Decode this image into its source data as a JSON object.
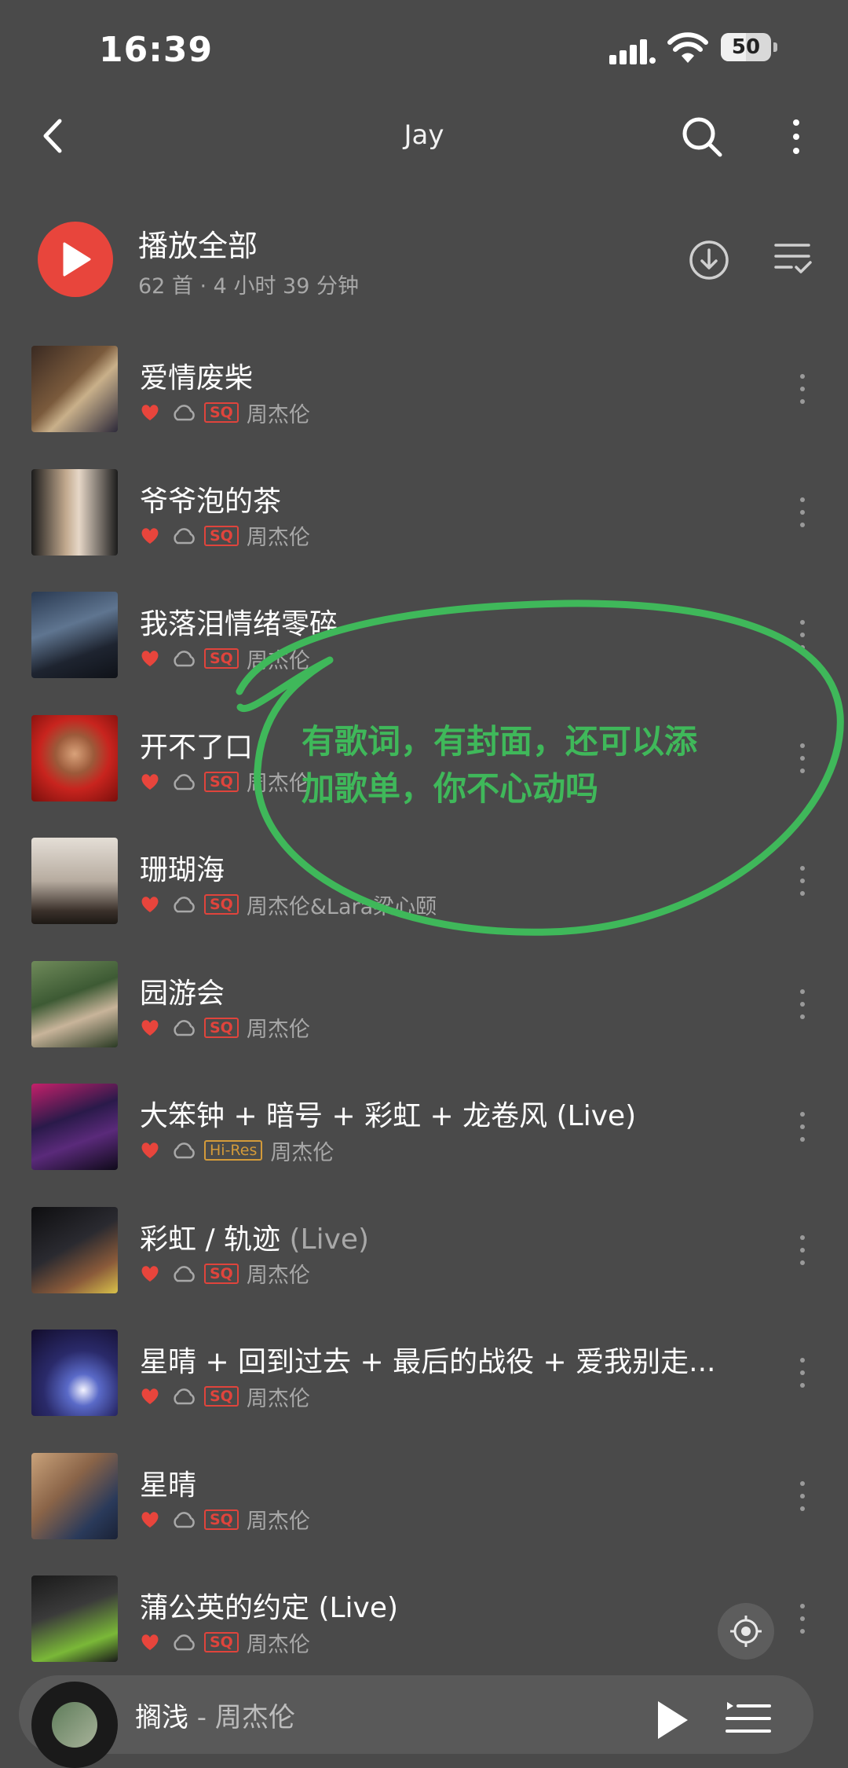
{
  "status_bar": {
    "time": "16:39",
    "battery": "50",
    "battery_level": 0.5
  },
  "header": {
    "title": "Jay"
  },
  "play_all": {
    "label": "播放全部",
    "summary": "62 首 · 4 小时 39 分钟"
  },
  "songs": [
    {
      "title": "爱情废柴",
      "live": "",
      "badge": "SQ",
      "artist": "周杰伦"
    },
    {
      "title": "爷爷泡的茶",
      "live": "",
      "badge": "SQ",
      "artist": "周杰伦"
    },
    {
      "title": "我落泪情绪零碎",
      "live": "",
      "badge": "SQ",
      "artist": "周杰伦"
    },
    {
      "title": "开不了口",
      "live": "",
      "badge": "SQ",
      "artist": "周杰伦"
    },
    {
      "title": "珊瑚海",
      "live": "",
      "badge": "SQ",
      "artist": "周杰伦&Lara梁心颐"
    },
    {
      "title": "园游会",
      "live": "",
      "badge": "SQ",
      "artist": "周杰伦"
    },
    {
      "title": "大笨钟 + 暗号 + 彩虹 + 龙卷风 (Live)",
      "live": "",
      "badge": "Hi-Res",
      "artist": "周杰伦"
    },
    {
      "title": "彩虹 / 轨迹 ",
      "live": "(Live)",
      "badge": "SQ",
      "artist": "周杰伦"
    },
    {
      "title": "星晴 + 回到过去 + 最后的战役 + 爱我别走...",
      "live": "",
      "badge": "SQ",
      "artist": "周杰伦"
    },
    {
      "title": "星晴",
      "live": "",
      "badge": "SQ",
      "artist": "周杰伦"
    },
    {
      "title": "蒲公英的约定 (Live)",
      "live": "",
      "badge": "SQ",
      "artist": "周杰伦"
    }
  ],
  "annotation": {
    "line1": "有歌词，有封面，还可以添",
    "line2": "加歌单，你不心动吗"
  },
  "mini_player": {
    "title": "搁浅",
    "artist": " - 周杰伦"
  },
  "colors": {
    "accent": "#e8453c",
    "background": "#4a4a4a",
    "annotation": "#3fb85a",
    "hires": "#d39a3a"
  }
}
